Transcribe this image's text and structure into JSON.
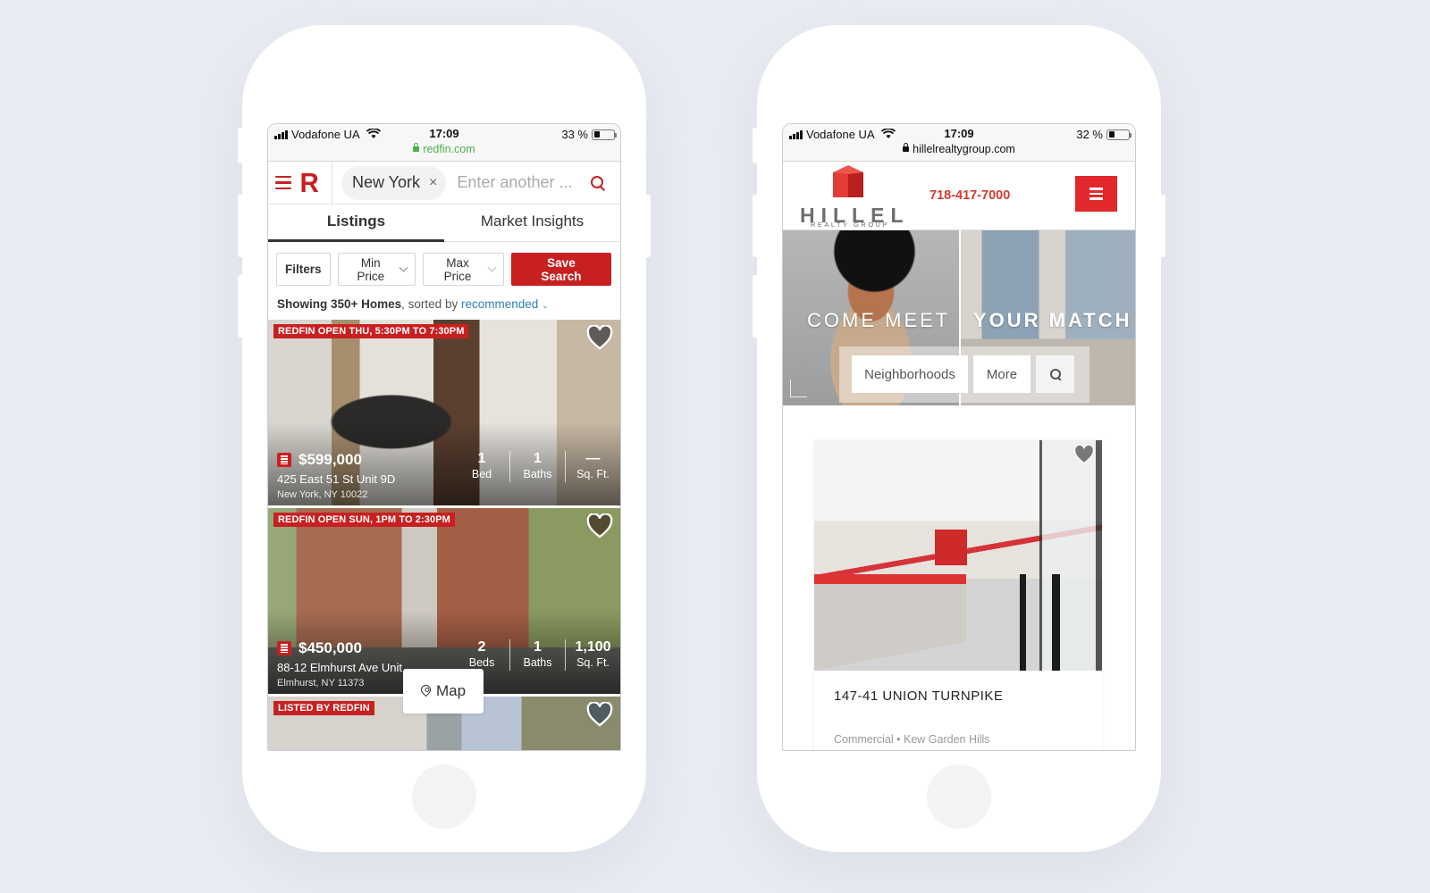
{
  "left_phone": {
    "status": {
      "carrier": "Vodafone UA",
      "time": "17:09",
      "battery": "33 %",
      "battery_level": 0.33,
      "url": "redfin.com",
      "url_color": "#4caf50"
    },
    "header": {
      "logo": "R",
      "search_chip": "New York",
      "chip_remove": "×",
      "search_placeholder": "Enter another ..."
    },
    "tabs": [
      {
        "label": "Listings",
        "active": true
      },
      {
        "label": "Market Insights",
        "active": false
      }
    ],
    "filters": {
      "filters_label": "Filters",
      "min_price": "Min Price",
      "max_price": "Max Price",
      "save_search": "Save Search"
    },
    "summary": {
      "count": "Showing 350+ Homes",
      "sorted_by": ", sorted by ",
      "sort_value": "recommended",
      "caret": "⌄"
    },
    "listings": [
      {
        "tag": "REDFIN OPEN THU, 5:30PM TO 7:30PM",
        "price": "$599,000",
        "address": "425 East 51 St Unit 9D",
        "city": "New York, NY 10022",
        "beds": "1",
        "beds_label": "Bed",
        "baths": "1",
        "baths_label": "Baths",
        "sqft": "—",
        "sqft_label": "Sq. Ft."
      },
      {
        "tag": "REDFIN OPEN SUN, 1PM TO 2:30PM",
        "price": "$450,000",
        "address": "88-12 Elmhurst Ave Unit",
        "city": "Elmhurst, NY 11373",
        "beds": "2",
        "beds_label": "Beds",
        "baths": "1",
        "baths_label": "Baths",
        "sqft": "1,100",
        "sqft_label": "Sq. Ft."
      },
      {
        "tag": "LISTED BY REDFIN"
      }
    ],
    "map_button": "Map"
  },
  "right_phone": {
    "status": {
      "carrier": "Vodafone UA",
      "time": "17:09",
      "battery": "32 %",
      "battery_level": 0.32,
      "url": "hillelrealtygroup.com"
    },
    "header": {
      "logo_word": "HILLEL",
      "logo_sub": "REALTY GROUP",
      "phone": "718-417-7000"
    },
    "hero": {
      "text_left": "COME MEET",
      "text_right": "YOUR MATCH",
      "neighborhoods": "Neighborhoods",
      "more": "More"
    },
    "card": {
      "title": "147-41 UNION TURNPIKE",
      "meta": "Commercial • Kew Garden Hills"
    }
  },
  "colors": {
    "redfin_red": "#c82021",
    "hillel_red": "#e1292b",
    "link_blue": "#2c82b8",
    "background": "#e9ecf2"
  }
}
